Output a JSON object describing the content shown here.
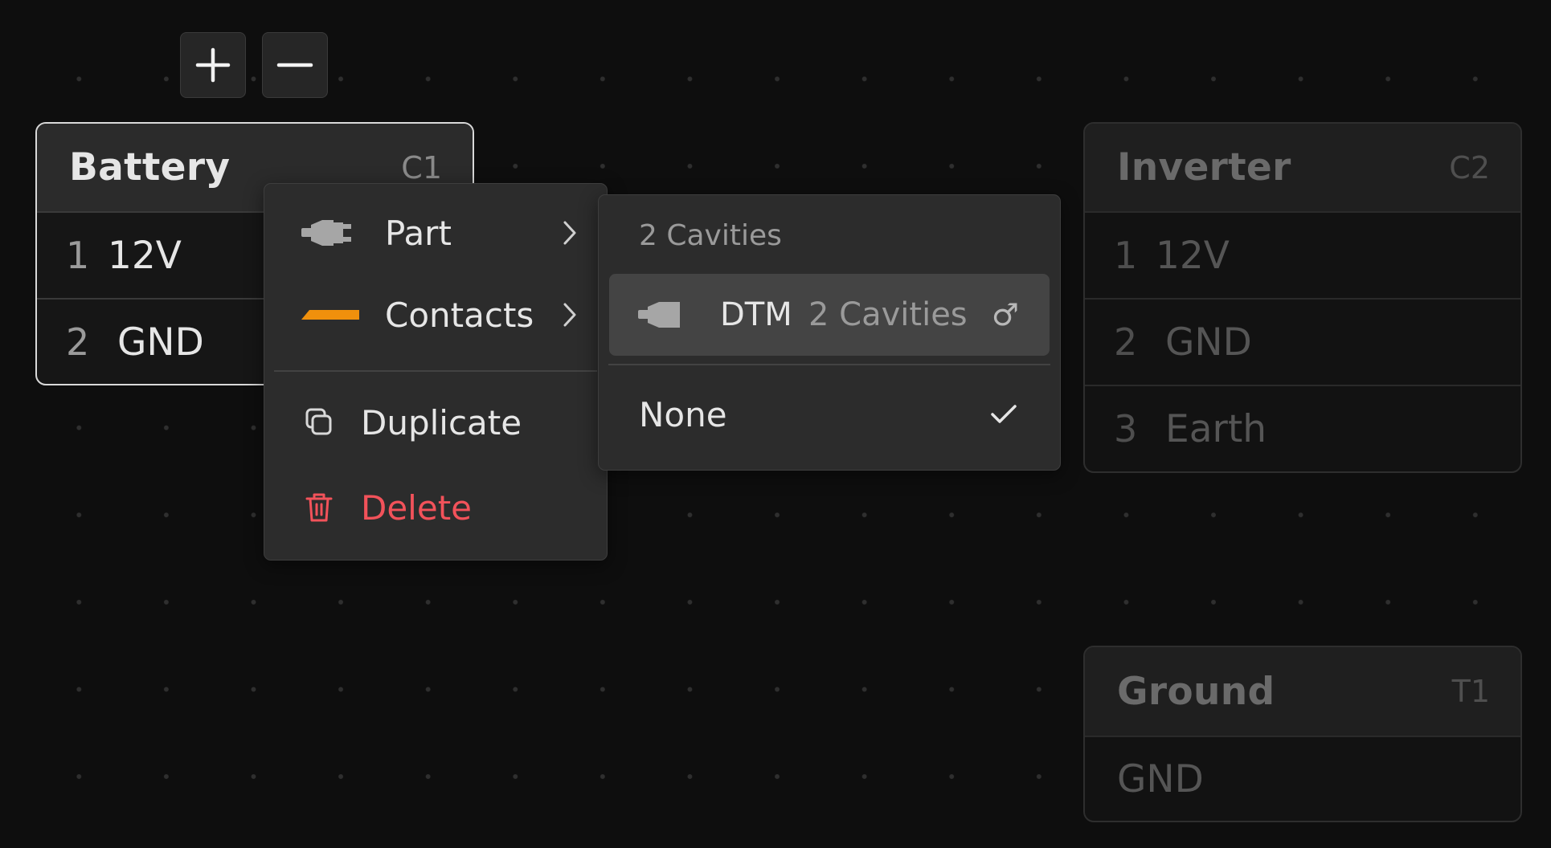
{
  "canvas": {
    "zoom_in_label": "+",
    "zoom_out_label": "−"
  },
  "nodes": {
    "battery": {
      "title": "Battery",
      "id": "C1",
      "rows": [
        {
          "num": "1",
          "label": "12V"
        },
        {
          "num": "2",
          "label": "GND"
        }
      ]
    },
    "inverter": {
      "title": "Inverter",
      "id": "C2",
      "rows": [
        {
          "num": "1",
          "label": "12V"
        },
        {
          "num": "2",
          "label": "GND"
        },
        {
          "num": "3",
          "label": "Earth"
        }
      ]
    },
    "ground": {
      "title": "Ground",
      "id": "T1",
      "rows": [
        {
          "label": "GND"
        }
      ]
    }
  },
  "context_menu": {
    "part": "Part",
    "contacts": "Contacts",
    "duplicate": "Duplicate",
    "delete": "Delete"
  },
  "part_submenu": {
    "heading": "2 Cavities",
    "options": [
      {
        "name": "DTM",
        "detail": "2 Cavities",
        "gender": "♂"
      },
      {
        "name": "None"
      }
    ]
  },
  "colors": {
    "accent_orange": "#f0900c",
    "danger_red": "#f2525a",
    "selected_border": "#d9d9d9",
    "background": "#0e0e0e"
  },
  "icons": {
    "part": "connector-plug-icon",
    "contacts": "contact-bar-icon",
    "duplicate": "duplicate-icon",
    "delete": "trash-icon",
    "submenu": "chevron-right-icon",
    "dtm_gender": "male-symbol-icon",
    "selected": "checkmark-icon"
  }
}
